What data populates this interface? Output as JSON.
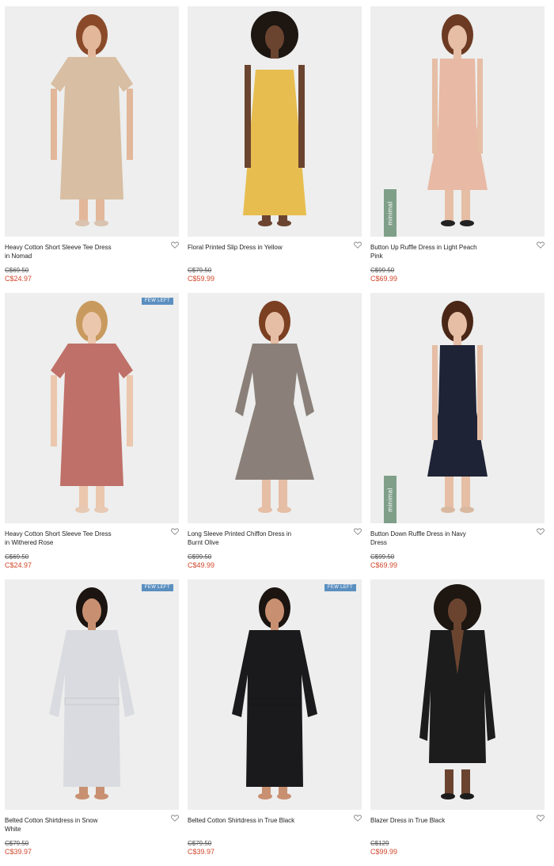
{
  "colors": {
    "sale": "#d2462b",
    "badge": "#5b8fc0",
    "minimal_tag": "#7f9f89"
  },
  "products": [
    {
      "name": "Heavy Cotton Short Sleeve Tee Dress in Nomad",
      "original_price": "C$69.50",
      "sale_price": "C$24.97",
      "badge": "",
      "tag": "",
      "dress_color": "#d8bea2",
      "skin": "#e2b79a",
      "hair": "#8a4a2a",
      "style": "tee",
      "shoes": "#d9c3b0"
    },
    {
      "name": "Floral Printed Slip Dress in Yellow",
      "original_price": "C$79.50",
      "sale_price": "C$59.99",
      "badge": "",
      "tag": "",
      "dress_color": "#e7bd50",
      "skin": "#6b4430",
      "hair": "#1d1611",
      "style": "slip",
      "shoes": "#6b4430"
    },
    {
      "name": "Button Up Ruffle Dress in Light Peach Pink",
      "original_price": "C$99.50",
      "sale_price": "C$69.99",
      "badge": "",
      "tag": "minimal",
      "dress_color": "#e8b9a5",
      "skin": "#e6bea5",
      "hair": "#6c3a22",
      "style": "ruffle",
      "shoes": "#222222"
    },
    {
      "name": "Heavy Cotton Short Sleeve Tee Dress in Withered Rose",
      "original_price": "C$69.50",
      "sale_price": "C$24.97",
      "badge": "FEW LEFT",
      "tag": "",
      "dress_color": "#bf7068",
      "skin": "#ebc7ad",
      "hair": "#c99a5e",
      "style": "tee",
      "shoes": "#e7c9b4"
    },
    {
      "name": "Long Sleeve Printed Chiffon Dress in Burnt Olive",
      "original_price": "C$99.50",
      "sale_price": "C$49.99",
      "badge": "",
      "tag": "",
      "dress_color": "#8a8079",
      "skin": "#e6bea5",
      "hair": "#7b3f22",
      "style": "chiffon",
      "shoes": "#e6bea5"
    },
    {
      "name": "Button Down Ruffle Dress in Navy Dress",
      "original_price": "C$99.50",
      "sale_price": "C$69.99",
      "badge": "",
      "tag": "minimal",
      "dress_color": "#1e2335",
      "skin": "#e6bea5",
      "hair": "#4a2617",
      "style": "ruffle",
      "shoes": "#d9b8a0"
    },
    {
      "name": "Belted Cotton Shirtdress in Snow White",
      "original_price": "C$79.50",
      "sale_price": "C$39.97",
      "badge": "FEW LEFT",
      "tag": "",
      "dress_color": "#d9dbe0",
      "skin": "#c89071",
      "hair": "#1b1410",
      "style": "shirt",
      "shoes": "#c89071"
    },
    {
      "name": "Belted Cotton Shirtdress in True Black",
      "original_price": "C$79.50",
      "sale_price": "C$39.97",
      "badge": "FEW LEFT",
      "tag": "",
      "dress_color": "#1a1a1c",
      "skin": "#c89071",
      "hair": "#1b1410",
      "style": "shirt",
      "shoes": "#c89071"
    },
    {
      "name": "Blazer Dress in True Black",
      "original_price": "C$129",
      "sale_price": "C$99.99",
      "badge": "",
      "tag": "",
      "dress_color": "#1c1c1c",
      "skin": "#6b4430",
      "hair": "#1d1611",
      "style": "blazer",
      "shoes": "#1c1c1c"
    }
  ]
}
